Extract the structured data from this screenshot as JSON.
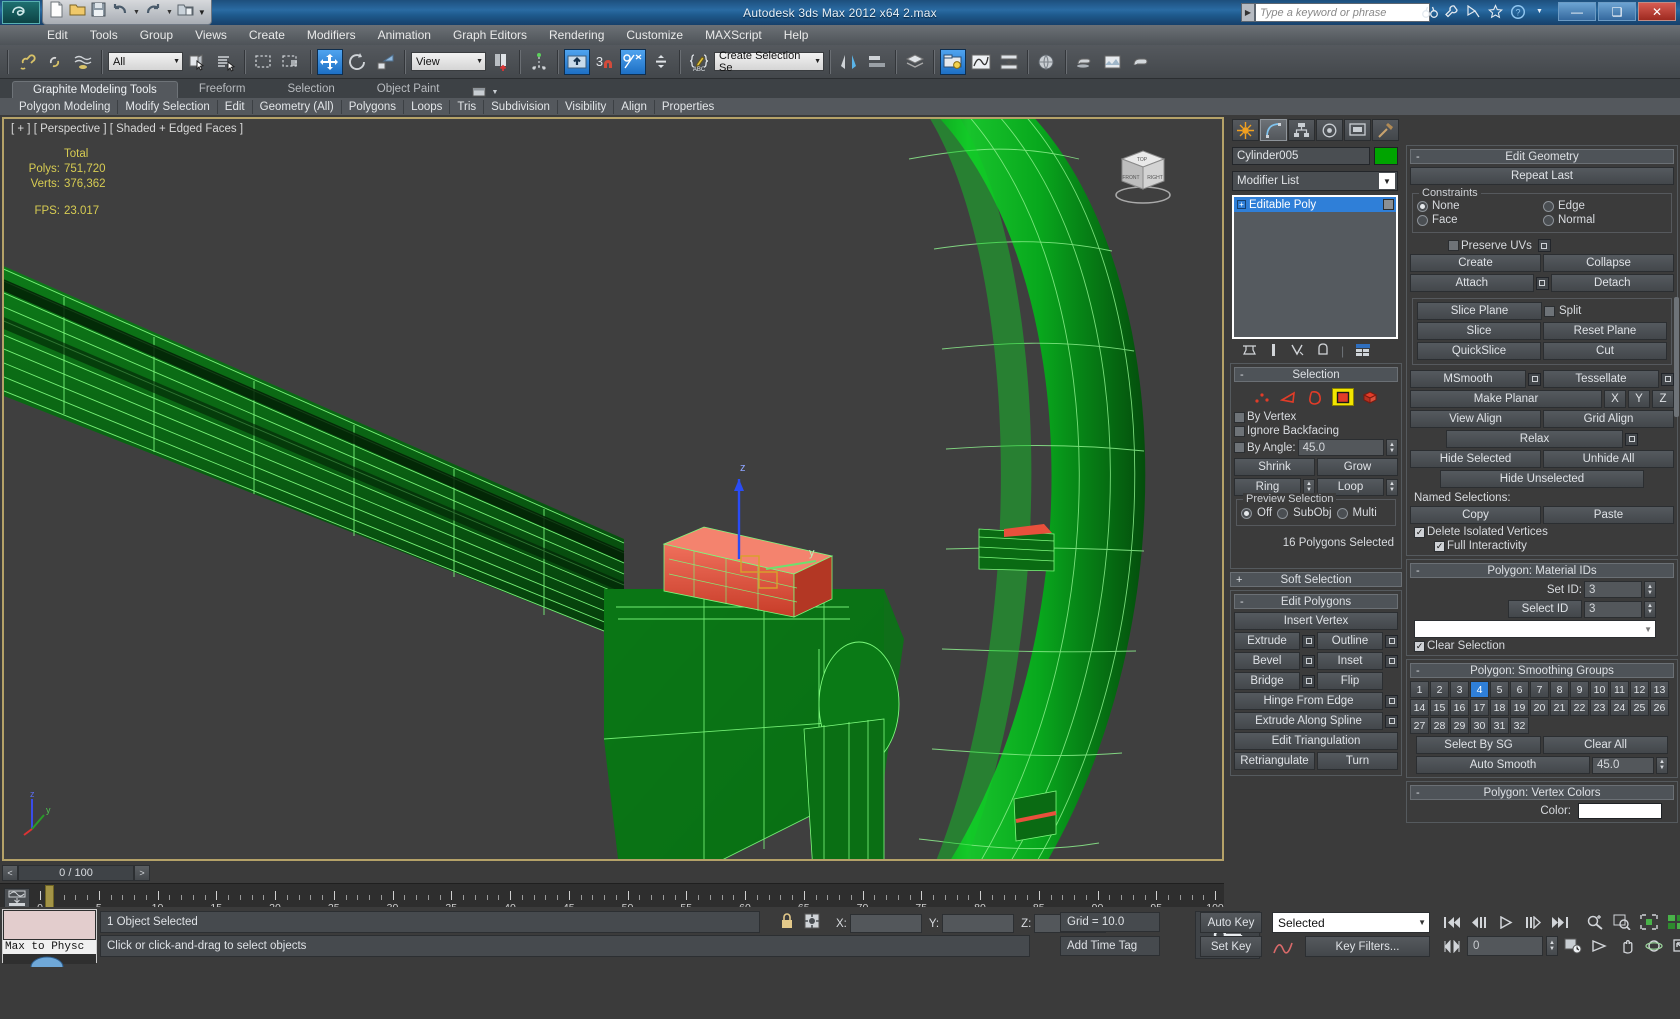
{
  "window": {
    "title": "Autodesk 3ds Max  2012 x64     2.max",
    "app_name": "Autodesk 3ds Max",
    "version": "2012 x64",
    "file": "2.max",
    "min_label": "—",
    "max_label": "❑",
    "close_label": "✕"
  },
  "search": {
    "placeholder": "Type a keyword or phrase",
    "icons": [
      "binoculars-icon",
      "wrench-icon",
      "satellite-icon",
      "star-icon",
      "help-icon"
    ]
  },
  "menu": {
    "items": [
      "Edit",
      "Tools",
      "Group",
      "Views",
      "Create",
      "Modifiers",
      "Animation",
      "Graph Editors",
      "Rendering",
      "Customize",
      "MAXScript",
      "Help"
    ]
  },
  "quick_access": {
    "items": [
      "new-file-icon",
      "open-file-icon",
      "save-file-icon",
      "undo-icon",
      "redo-icon",
      "project-folder-icon",
      "qat-chevron-icon"
    ]
  },
  "toolbar": {
    "selection_filter": "All",
    "reference_coord": "View",
    "named_selection_sets": "Create Selection Se",
    "angle_snap_value": "3",
    "buttons": [
      "select-and-link-icon",
      "unlink-selection-icon",
      "bind-to-space-warp-icon",
      "select-object-icon",
      "select-by-name-icon",
      "rectangular-selection-region-icon",
      "window-crossing-icon",
      "select-and-move-icon",
      "select-and-rotate-icon",
      "select-and-scale-icon",
      "use-center-flyout-icon",
      "select-and-manipulate-icon",
      "snaps-toggle-icon",
      "angle-snap-toggle-icon",
      "percent-snap-toggle-icon",
      "spinner-snap-toggle-icon",
      "edit-named-selection-sets-icon",
      "mirror-icon",
      "align-icon",
      "layer-manager-icon",
      "graphite-toggle-icon",
      "curve-editor-icon",
      "schematic-view-icon",
      "material-editor-icon",
      "render-setup-icon",
      "rendered-frame-window-icon",
      "render-production-icon"
    ]
  },
  "ribbon": {
    "tabs": [
      {
        "label": "Graphite Modeling Tools",
        "active": true
      },
      {
        "label": "Freeform",
        "active": false
      },
      {
        "label": "Selection",
        "active": false
      },
      {
        "label": "Object Paint",
        "active": false
      }
    ],
    "flyout_icon": "ribbon-flyout-icon",
    "subtabs": [
      "Polygon Modeling",
      "Modify Selection",
      "Edit",
      "Geometry (All)",
      "Polygons",
      "Loops",
      "Tris",
      "Subdivision",
      "Visibility",
      "Align",
      "Properties"
    ]
  },
  "viewport": {
    "label": "[ + ] [ Perspective ] [ Shaded + Edged Faces ]",
    "stats": {
      "header": "Total",
      "polys_label": "Polys:",
      "polys_value": "751,720",
      "verts_label": "Verts:",
      "verts_value": "376,362",
      "fps_label": "FPS:",
      "fps_value": "23.017"
    },
    "viewcube_faces": [
      "TOP",
      "FRONT",
      "RIGHT"
    ],
    "axis_labels": [
      "x",
      "y",
      "z"
    ],
    "colors": {
      "mesh_green": "#0a9a1e",
      "selection_red": "#e8503c",
      "wireframe": "#6ef06e",
      "border": "#b5a268",
      "background": "#3f3f3f"
    }
  },
  "timeline": {
    "frame_display": "0 / 100",
    "prev_label": "<",
    "next_label": ">",
    "range_start": 0,
    "range_end": 100,
    "major_ticks": [
      0,
      5,
      10,
      15,
      20,
      25,
      30,
      35,
      40,
      45,
      50,
      55,
      60,
      65,
      70,
      75,
      80,
      85,
      90,
      95,
      100
    ],
    "current_frame": 0
  },
  "status": {
    "max_to_physical": "Max to Physc",
    "objects_selected": "1 Object Selected",
    "prompt": "Click or click-and-drag to select objects",
    "x_label": "X:",
    "y_label": "Y:",
    "z_label": "Z:",
    "x_value": "",
    "y_value": "",
    "z_value": "",
    "grid": "Grid = 10.0",
    "add_time_tag": "Add Time Tag",
    "lock_icon": "lock-selection-icon",
    "absolute_mode_icon": "absolute-relative-transform-icon"
  },
  "animation_bar": {
    "auto_key": "Auto Key",
    "set_key": "Set Key",
    "key_mode": "Selected",
    "key_filters": "Key Filters...",
    "current_frame": "0",
    "transport": [
      "goto-start-icon",
      "previous-frame-icon",
      "play-icon",
      "next-frame-icon",
      "goto-end-icon"
    ],
    "viewport_nav": [
      "zoom-icon",
      "zoom-all-icon",
      "zoom-extents-icon",
      "zoom-extents-all-icon",
      "field-of-view-icon",
      "pan-icon",
      "orbit-icon",
      "maximize-viewport-icon"
    ]
  },
  "command_panel": {
    "tabs": [
      "create-tab-icon",
      "modify-tab-icon",
      "hierarchy-tab-icon",
      "motion-tab-icon",
      "display-tab-icon",
      "utilities-tab-icon"
    ],
    "active_tab_index": 1,
    "object_name": "Cylinder005",
    "object_color": "#00a400",
    "modifier_list_label": "Modifier List",
    "stack": [
      {
        "label": "Editable Poly",
        "selected": true
      }
    ],
    "stack_buttons": [
      "pin-stack-icon",
      "show-end-result-icon",
      "make-unique-icon",
      "remove-modifier-icon",
      "configure-sets-icon"
    ]
  },
  "selection_rollout": {
    "title": "Selection",
    "sub_object_icons": [
      "vertex-icon",
      "edge-icon",
      "border-icon",
      "polygon-icon",
      "element-icon"
    ],
    "active_sub_object_index": 3,
    "by_vertex": {
      "label": "By Vertex",
      "checked": false
    },
    "ignore_backfacing": {
      "label": "Ignore Backfacing",
      "checked": false
    },
    "by_angle": {
      "label": "By Angle:",
      "checked": false,
      "value": "45.0"
    },
    "shrink": "Shrink",
    "grow": "Grow",
    "ring": "Ring",
    "loop": "Loop",
    "preview_selection": {
      "title": "Preview Selection",
      "options": [
        "Off",
        "SubObj",
        "Multi"
      ],
      "selected": "Off"
    },
    "status": "16 Polygons Selected"
  },
  "soft_selection": {
    "title": "Soft Selection",
    "expanded": false
  },
  "edit_polygons": {
    "title": "Edit Polygons",
    "insert_vertex": "Insert Vertex",
    "extrude": "Extrude",
    "outline": "Outline",
    "bevel": "Bevel",
    "inset": "Inset",
    "bridge": "Bridge",
    "flip": "Flip",
    "hinge_from_edge": "Hinge From Edge",
    "extrude_along_spline": "Extrude Along Spline",
    "edit_triangulation": "Edit Triangulation",
    "retriangulate": "Retriangulate",
    "turn": "Turn"
  },
  "edit_geometry": {
    "title": "Edit Geometry",
    "repeat_last": "Repeat Last",
    "constraints": {
      "title": "Constraints",
      "options": [
        "None",
        "Edge",
        "Face",
        "Normal"
      ],
      "selected": "None"
    },
    "preserve_uvs": {
      "label": "Preserve UVs",
      "checked": false
    },
    "create": "Create",
    "collapse": "Collapse",
    "attach": "Attach",
    "detach": "Detach",
    "slice_plane": "Slice Plane",
    "split": {
      "label": "Split",
      "checked": false
    },
    "slice": "Slice",
    "reset_plane": "Reset Plane",
    "quickslice": "QuickSlice",
    "cut": "Cut",
    "msmooth": "MSmooth",
    "tessellate": "Tessellate",
    "make_planar": "Make Planar",
    "axes": [
      "X",
      "Y",
      "Z"
    ],
    "view_align": "View Align",
    "grid_align": "Grid Align",
    "relax": "Relax",
    "hide_selected": "Hide Selected",
    "unhide_all": "Unhide All",
    "hide_unselected": "Hide Unselected",
    "named_selections_label": "Named Selections:",
    "copy": "Copy",
    "paste": "Paste",
    "delete_isolated_vertices": {
      "label": "Delete Isolated Vertices",
      "checked": true
    },
    "full_interactivity": {
      "label": "Full Interactivity",
      "checked": true
    }
  },
  "material_ids": {
    "title": "Polygon: Material IDs",
    "set_id_label": "Set ID:",
    "set_id_value": "3",
    "select_id_label": "Select ID",
    "select_id_value": "3",
    "id_dropdown_value": "",
    "clear_selection": {
      "label": "Clear Selection",
      "checked": true
    }
  },
  "smoothing_groups": {
    "title": "Polygon: Smoothing Groups",
    "cells": [
      1,
      2,
      3,
      4,
      5,
      6,
      7,
      8,
      9,
      10,
      11,
      12,
      13,
      14,
      15,
      16,
      17,
      18,
      19,
      20,
      21,
      22,
      23,
      24,
      25,
      26,
      27,
      28,
      29,
      30,
      31,
      32
    ],
    "active": [
      4
    ],
    "select_by_sg": "Select By SG",
    "clear_all": "Clear All",
    "auto_smooth": "Auto Smooth",
    "auto_smooth_value": "45.0"
  },
  "vertex_colors": {
    "title": "Polygon: Vertex Colors",
    "color_label": "Color:",
    "color_value": "#ffffff"
  }
}
